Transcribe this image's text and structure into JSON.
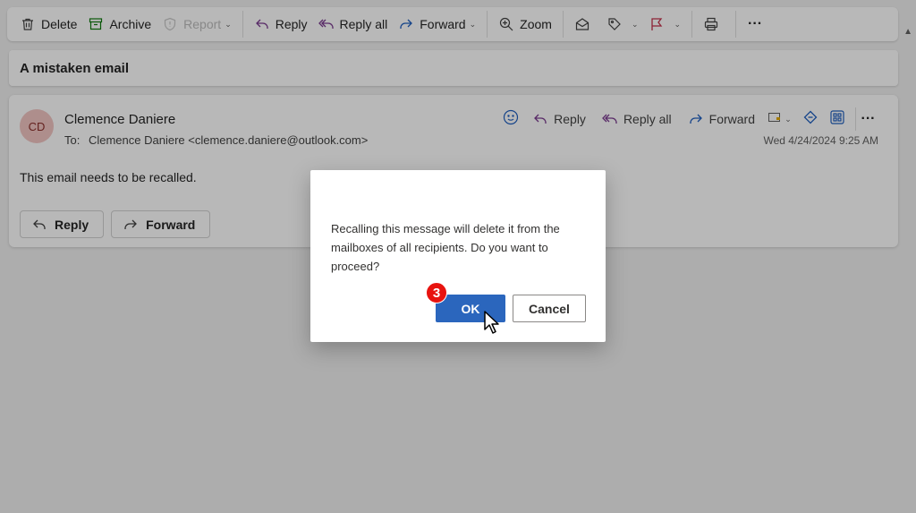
{
  "toolbar": {
    "delete": "Delete",
    "archive": "Archive",
    "report": "Report",
    "reply": "Reply",
    "reply_all": "Reply all",
    "forward": "Forward",
    "zoom": "Zoom"
  },
  "email": {
    "subject": "A mistaken email",
    "avatar_initials": "CD",
    "sender": "Clemence Daniere",
    "to_label": "To:",
    "to_value": "Clemence Daniere <clemence.daniere@outlook.com>",
    "date": "Wed 4/24/2024 9:25 AM",
    "body": "This email needs to be recalled.",
    "actions": {
      "reply": "Reply",
      "reply_all": "Reply all",
      "forward": "Forward"
    },
    "quick": {
      "reply": "Reply",
      "forward": "Forward"
    }
  },
  "dialog": {
    "message": "Recalling this message will delete it from the mailboxes of all recipients. Do you want to proceed?",
    "ok": "OK",
    "cancel": "Cancel"
  },
  "annotation": {
    "step": "3"
  },
  "colors": {
    "accent": "#2b66bd",
    "badge": "#e8130f",
    "avatar_bg": "#f1c5c3"
  }
}
